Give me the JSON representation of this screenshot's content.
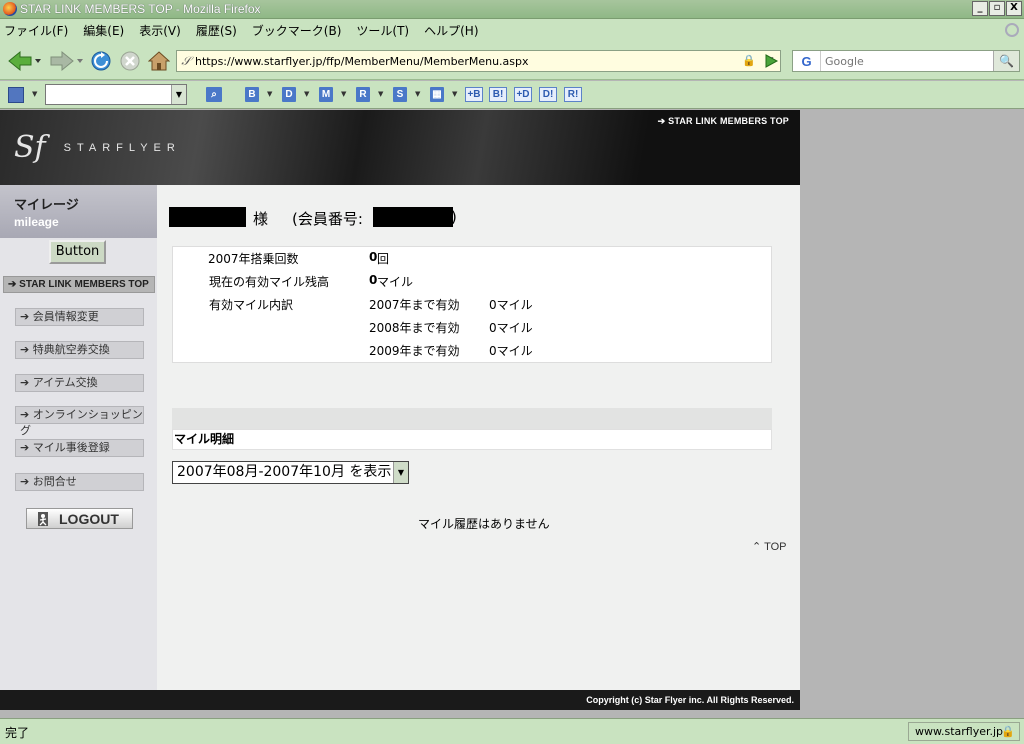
{
  "window": {
    "title": "STAR LINK MEMBERS TOP - Mozilla Firefox",
    "min": "_",
    "max": "▫",
    "close": "X"
  },
  "menu": [
    "ファイル(F)",
    "編集(E)",
    "表示(V)",
    "履歴(S)",
    "ブックマーク(B)",
    "ツール(T)",
    "ヘルプ(H)"
  ],
  "nav": {
    "url": "https://www.starflyer.jp/ffp/MemberMenu/MemberMenu.aspx",
    "search_engine": "G",
    "search_placeholder": "Google"
  },
  "toolbar2": {
    "items": [
      "B",
      "D",
      "M",
      "R",
      "S",
      "+B",
      "B!",
      "+D",
      "D!",
      "R!"
    ]
  },
  "site": {
    "top_link": "STAR LINK MEMBERS TOP",
    "logo_mark": "Sf",
    "logo_text": "STARFLYER",
    "copyright": "Copyright (c) Star Flyer inc. All Rights Reserved."
  },
  "sidebar": {
    "title_jp": "マイレージ",
    "title_en": "mileage",
    "button": "Button",
    "top_nav": "STAR LINK MEMBERS TOP",
    "items": [
      "会員情報変更",
      "特典航空券交換",
      "アイテム交換",
      "オンラインショッピング",
      "マイル事後登録",
      "お問合せ"
    ],
    "logout": "LOGOUT"
  },
  "member": {
    "honorific": "様",
    "number_label": "(会員番号:",
    "number_end": ")"
  },
  "summary": {
    "flights_label": "2007年搭乗回数",
    "flights_value": "0",
    "flights_unit": "回",
    "balance_label": "現在の有効マイル残高",
    "balance_value": "0",
    "balance_unit": "マイル",
    "breakdown_label": "有効マイル内訳",
    "breakdown": [
      {
        "period": "2007年まで有効",
        "miles": "0マイル"
      },
      {
        "period": "2008年まで有効",
        "miles": "0マイル"
      },
      {
        "period": "2009年まで有効",
        "miles": "0マイル"
      }
    ]
  },
  "detail": {
    "title": "マイル明細",
    "period_selected": "2007年08月-2007年10月 を表示",
    "no_history": "マイル履歴はありません",
    "page_top": "TOP"
  },
  "status": {
    "text": "完了",
    "domain": "www.starflyer.jp"
  }
}
